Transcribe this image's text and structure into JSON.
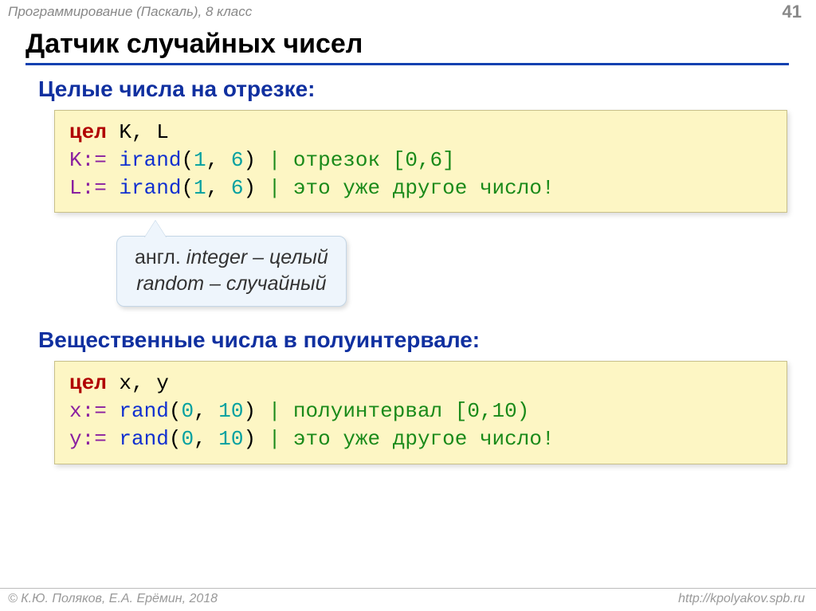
{
  "header": {
    "breadcrumb": "Программирование (Паскаль), 8 класс",
    "page": "41"
  },
  "title": "Датчик случайных чисел",
  "section1": "Целые числа на отрезке:",
  "code1": {
    "decl_kw": "цел",
    "decl_vars": " K, L",
    "l2_lhs": "K:=",
    "l2_fn": "irand",
    "l2_open": "(",
    "l2_a": "1",
    "l2_sep": ",",
    "l2_b": "6",
    "l2_close": ")",
    "l2_com": " | отрезок [0,6]",
    "l3_lhs": "L:=",
    "l3_fn": "irand",
    "l3_open": "(",
    "l3_a": "1",
    "l3_sep": ",",
    "l3_b": "6",
    "l3_close": ")",
    "l3_com": " | это уже другое число!"
  },
  "note": {
    "line1a": "англ. ",
    "line1b": "integer",
    "line1c": " – целый",
    "line2a": "random",
    "line2b": " – случайный"
  },
  "section2": "Вещественные числа в полуинтервале:",
  "code2": {
    "decl_kw": "цел",
    "decl_vars": " x, y",
    "l2_lhs": "x:=",
    "l2_fn": "rand",
    "l2_open": "(",
    "l2_a": "0",
    "l2_sep": ",",
    "l2_b": "10",
    "l2_close": ")",
    "l2_com": " | полуинтервал [0,10)",
    "l3_lhs": "y:=",
    "l3_fn": "rand",
    "l3_open": "(",
    "l3_a": "0",
    "l3_sep": ",",
    "l3_b": "10",
    "l3_close": ")",
    "l3_com": " | это уже другое число!"
  },
  "footer": {
    "copyright": "© К.Ю. Поляков, Е.А. Ерёмин, 2018",
    "url": "http://kpolyakov.spb.ru"
  }
}
